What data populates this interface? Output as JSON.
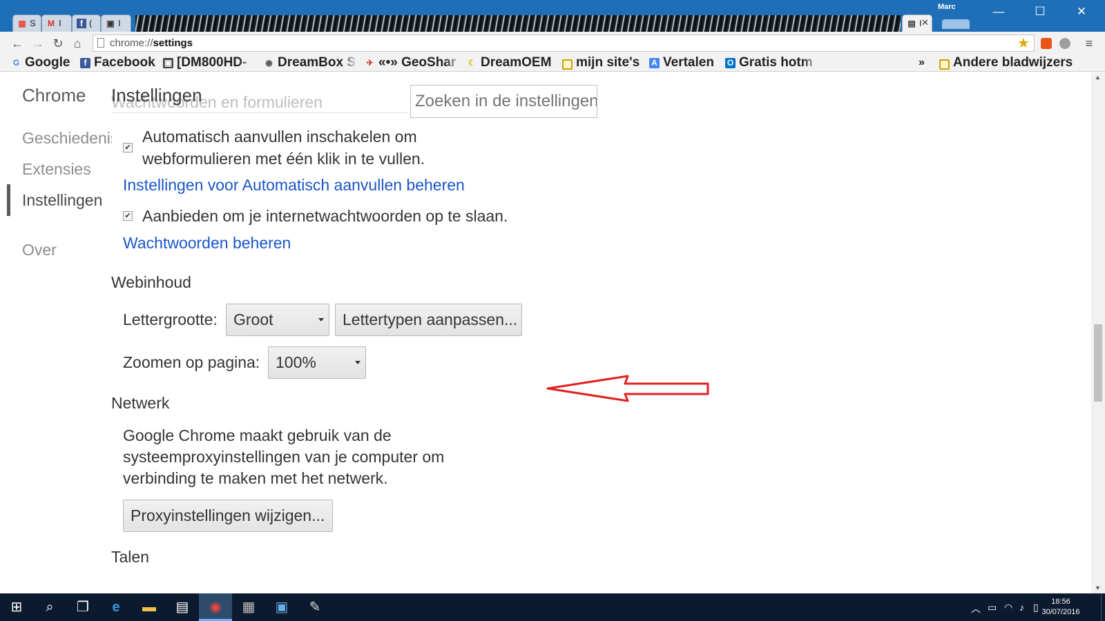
{
  "window": {
    "profile_name": "Marc",
    "tabs": [
      {
        "label": "S",
        "icon": "windows-icon"
      },
      {
        "label": "I",
        "icon": "gmail-icon"
      },
      {
        "label": "(",
        "icon": "facebook-icon"
      },
      {
        "label": "I",
        "icon": "dreambox-icon"
      },
      {
        "label": "I",
        "icon": "settings-page-icon"
      }
    ]
  },
  "toolbar": {
    "url_prefix": "chrome://",
    "url_path": "settings"
  },
  "bookmarks": [
    {
      "label": "Google",
      "icon": "google-icon",
      "color": "#4285f4"
    },
    {
      "label": "Facebook",
      "icon": "facebook-icon",
      "color": "#3b5998"
    },
    {
      "label": "[DM800HD-",
      "icon": "dreambox-icon",
      "color": "#444444"
    },
    {
      "label": "DreamBox S",
      "icon": "dreambox-logo-icon",
      "color": "#555555"
    },
    {
      "label": "«•» GeoShar",
      "icon": "satellite-icon",
      "color": "#c0392b"
    },
    {
      "label": "DreamOEM",
      "icon": "banana-icon",
      "color": "#f1c40f"
    },
    {
      "label": "mijn site's",
      "icon": "folder-icon",
      "color": "#c9a100"
    },
    {
      "label": "Vertalen",
      "icon": "translate-icon",
      "color": "#4285f4"
    },
    {
      "label": "Gratis hotm",
      "icon": "outlook-icon",
      "color": "#0072c6"
    },
    {
      "label": "»",
      "icon": "chevron-icon",
      "color": "#333333"
    },
    {
      "label": "Andere bladwijzers",
      "icon": "folder-icon",
      "color": "#c9a100"
    }
  ],
  "sidebar": {
    "title": "Chrome",
    "items": [
      {
        "label": "Geschiedenis"
      },
      {
        "label": "Extensies"
      },
      {
        "label": "Instellingen"
      },
      {
        "label": "Over"
      }
    ]
  },
  "main": {
    "title": "Instellingen",
    "ghost_heading": "Wachtwoorden en formulieren",
    "search_placeholder": "Zoeken in de instellingen",
    "autofill_checkbox": {
      "checked": true,
      "line1": "Automatisch aanvullen inschakelen om",
      "line2": "webformulieren met één klik in te vullen."
    },
    "autofill_link": "Instellingen voor Automatisch aanvullen beheren",
    "password_checkbox": {
      "checked": true,
      "label": "Aanbieden om je internetwachtwoorden op te slaan."
    },
    "password_link": "Wachtwoorden beheren",
    "web_content": {
      "heading": "Webinhoud",
      "font_size_label": "Lettergrootte:",
      "font_size_value": "Groot",
      "customize_fonts_button": "Lettertypen aanpassen...",
      "zoom_label": "Zoomen op pagina:",
      "zoom_value": "100%"
    },
    "network": {
      "heading": "Netwerk",
      "line1": "Google Chrome maakt gebruik van de",
      "line2": "systeemproxyinstellingen van je computer om",
      "line3": "verbinding te maken met het netwerk.",
      "proxy_button": "Proxyinstellingen wijzigen..."
    },
    "languages": {
      "heading": "Talen"
    }
  },
  "annotation": {
    "color": "#e02020"
  },
  "taskbar": {
    "time": "18:56",
    "date": "30/07/2016",
    "accent": "#6fb0ff"
  }
}
